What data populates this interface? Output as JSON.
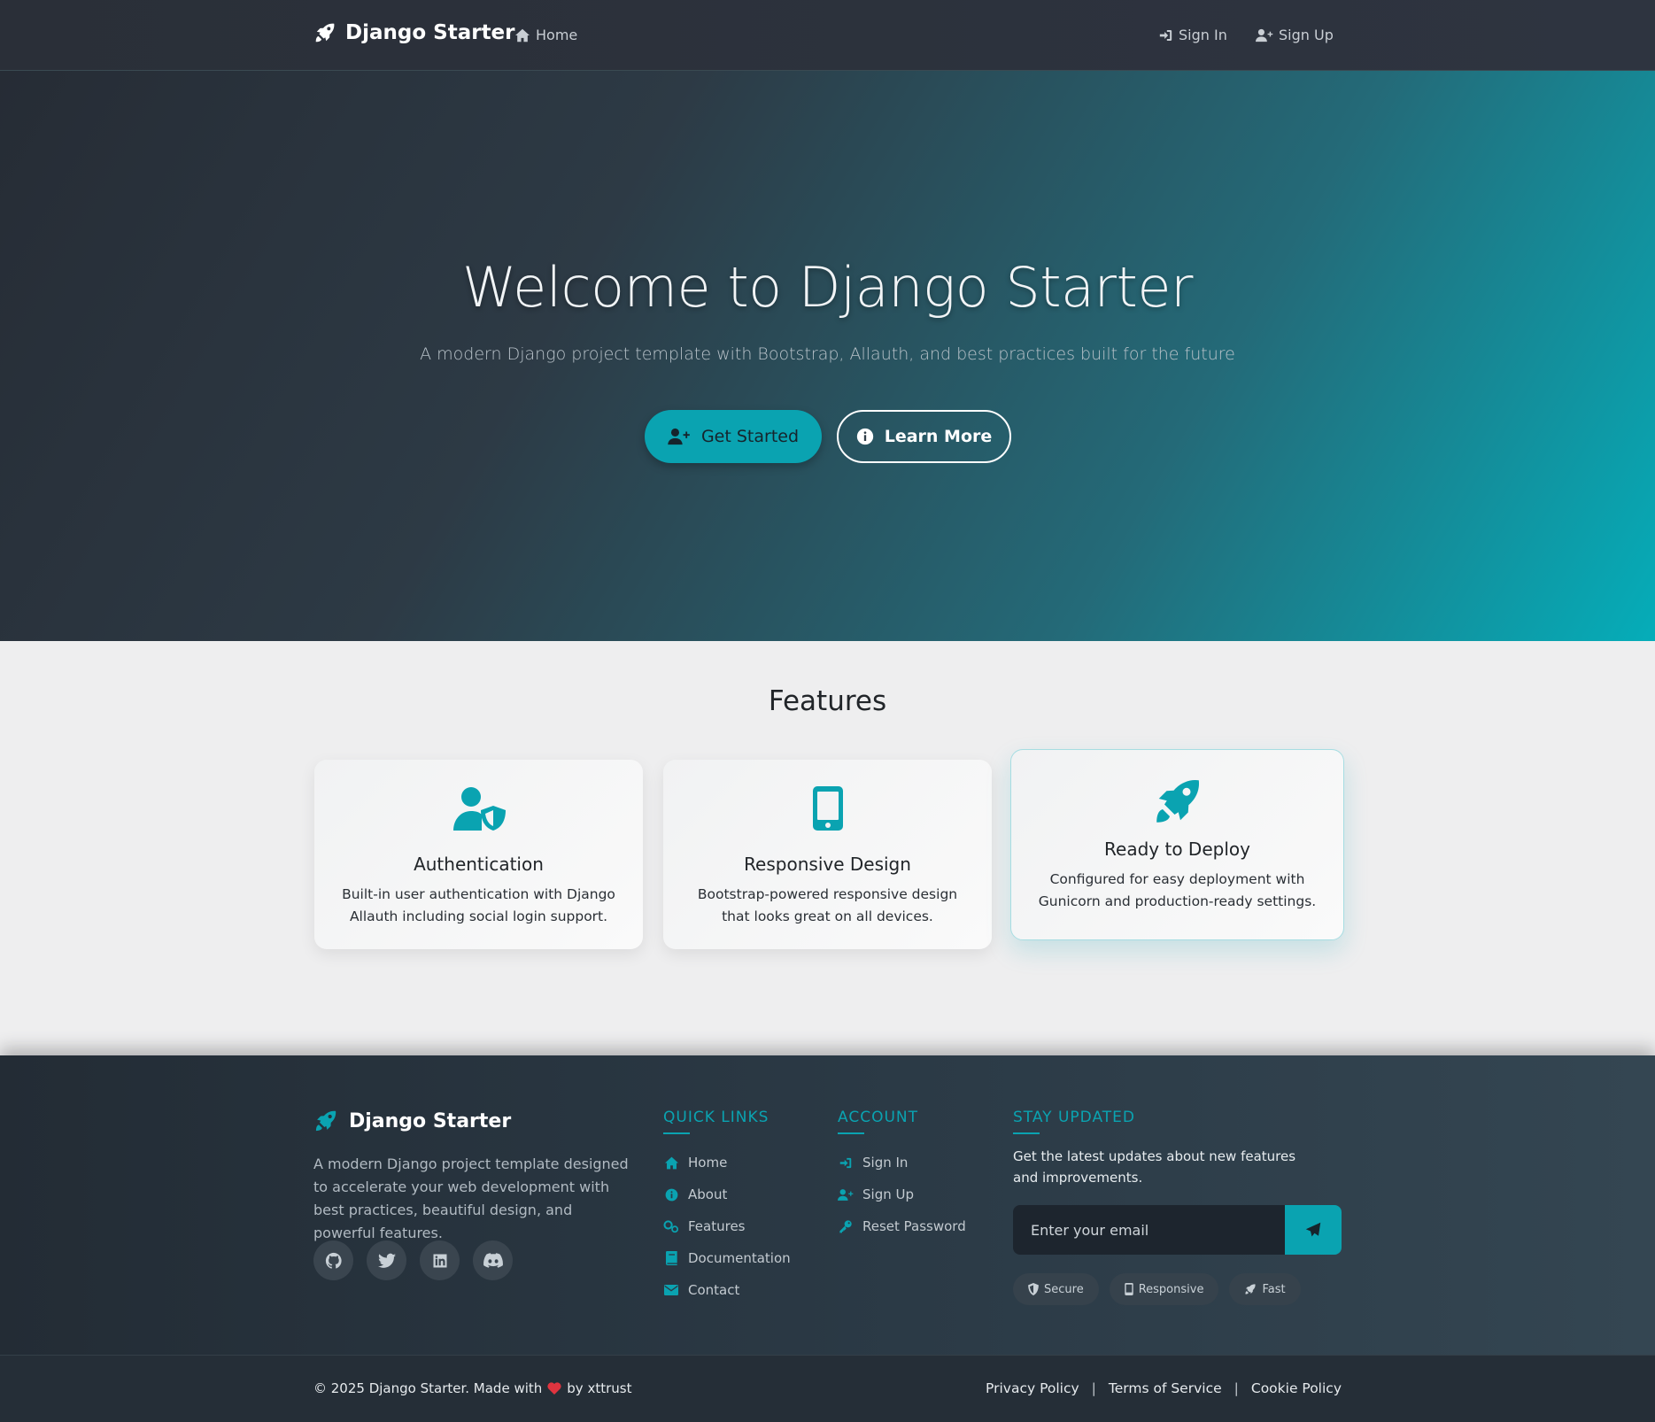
{
  "nav": {
    "brand": "Django Starter",
    "home": "Home",
    "sign_in": "Sign In",
    "sign_up": "Sign Up"
  },
  "hero": {
    "title": "Welcome to Django Starter",
    "subtitle": "A modern Django project template with Bootstrap, Allauth, and best practices built for the future",
    "primary_button": "Get Started",
    "secondary_button": "Learn More"
  },
  "features": {
    "title": "Features",
    "cards": [
      {
        "icon": "user-shield-icon",
        "title": "Authentication",
        "text": "Built-in user authentication with Django Allauth including social login support."
      },
      {
        "icon": "mobile-icon",
        "title": "Responsive Design",
        "text": "Bootstrap-powered responsive design that looks great on all devices."
      },
      {
        "icon": "rocket-icon",
        "title": "Ready to Deploy",
        "text": "Configured for easy deployment with Gunicorn and production-ready settings."
      }
    ]
  },
  "footer": {
    "brand": "Django Starter",
    "description": "A modern Django project template designed to accelerate your web development with best practices, beautiful design, and powerful features.",
    "socials": [
      "github-icon",
      "twitter-icon",
      "linkedin-icon",
      "discord-icon"
    ],
    "quick_links": {
      "title": "QUICK LINKS",
      "items": [
        {
          "icon": "home-icon",
          "label": "Home"
        },
        {
          "icon": "info-icon",
          "label": "About"
        },
        {
          "icon": "cogs-icon",
          "label": "Features"
        },
        {
          "icon": "book-icon",
          "label": "Documentation"
        },
        {
          "icon": "envelope-icon",
          "label": "Contact"
        }
      ]
    },
    "account": {
      "title": "ACCOUNT",
      "items": [
        {
          "icon": "sign-in-icon",
          "label": "Sign In"
        },
        {
          "icon": "user-plus-icon",
          "label": "Sign Up"
        },
        {
          "icon": "key-icon",
          "label": "Reset Password"
        }
      ]
    },
    "newsletter": {
      "title": "STAY UPDATED",
      "text": "Get the latest updates about new features and improvements.",
      "placeholder": "Enter your email",
      "badges": [
        {
          "icon": "shield-icon",
          "label": "Secure"
        },
        {
          "icon": "mobile-icon",
          "label": "Responsive"
        },
        {
          "icon": "rocket-icon",
          "label": "Fast"
        }
      ]
    },
    "copyright_prefix": "© 2025 Django Starter. Made with",
    "copyright_suffix": "by xttrust",
    "legal": [
      "Privacy Policy",
      "Terms of Service",
      "Cookie Policy"
    ]
  },
  "colors": {
    "accent": "#0aa3b1",
    "heart": "#e0343f"
  }
}
